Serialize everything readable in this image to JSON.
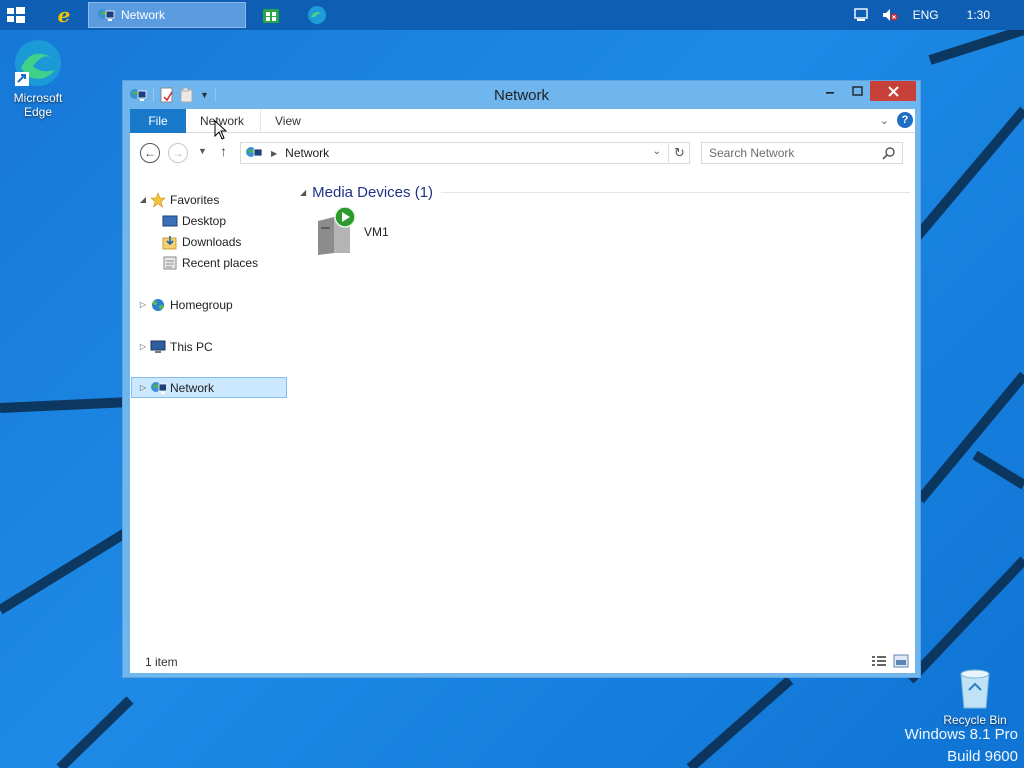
{
  "taskbar": {
    "active_window_label": "Network",
    "language": "ENG",
    "clock": "1:30"
  },
  "desktop": {
    "edge_label_line1": "Microsoft",
    "edge_label_line2": "Edge",
    "recycle_label": "Recycle Bin",
    "watermark_line1": "Windows 8.1 Pro",
    "watermark_line2": "Build 9600"
  },
  "window": {
    "title": "Network",
    "ribbon_tabs": [
      "File",
      "Network",
      "View"
    ],
    "address_crumb": "Network",
    "search_placeholder": "Search Network",
    "nav_pane": {
      "favorites": "Favorites",
      "favorites_children": [
        "Desktop",
        "Downloads",
        "Recent places"
      ],
      "homegroup": "Homegroup",
      "this_pc": "This PC",
      "network": "Network"
    },
    "group_header": "Media Devices (1)",
    "items": [
      {
        "label": "VM1"
      }
    ],
    "status": "1 item"
  },
  "colors": {
    "accent": "#1979ca",
    "selection": "#cce8ff",
    "close_button": "#c7403a",
    "taskbar": "#0e5fb3"
  }
}
